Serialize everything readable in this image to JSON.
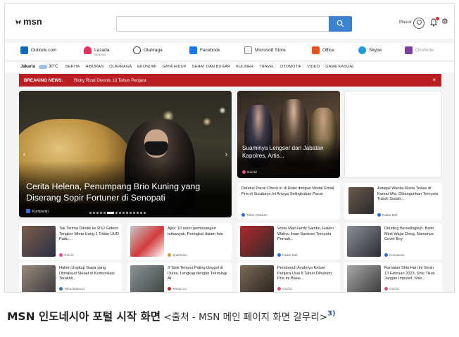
{
  "header": {
    "logo": "msn",
    "search_placeholder": "",
    "signin": "Masuk"
  },
  "quicklinks": [
    {
      "label": "Outlook.com",
      "color": "#0f6cbd",
      "icon": "outlook-icon"
    },
    {
      "label": "Lazada",
      "sub": "Sponsor",
      "color": "#e4325f",
      "icon": "lazada-icon"
    },
    {
      "label": "Olahraga",
      "color": "#444444",
      "icon": "sports-icon"
    },
    {
      "label": "Facebook",
      "color": "#1877f2",
      "icon": "facebook-icon"
    },
    {
      "label": "Microsoft Store",
      "color": "#777777",
      "icon": "store-icon"
    },
    {
      "label": "Office",
      "color": "#e5541c",
      "icon": "office-icon"
    },
    {
      "label": "Skype",
      "color": "#1e9bd8",
      "icon": "skype-icon"
    },
    {
      "label": "OneNote",
      "color": "#7b3fa0",
      "icon": "onenote-icon"
    }
  ],
  "nav": {
    "city": "Jakarta",
    "temp": "30°C",
    "items": [
      "BERITA",
      "HIBURAN",
      "OLAHRAGA",
      "EKONOMI",
      "GAYA HIDUP",
      "SEHAT DAN BUGAR",
      "KULINER",
      "TRAVEL",
      "OTOMOTIF",
      "VIDEO",
      "GAME KASUAL"
    ]
  },
  "breaking": {
    "label": "BREAKING NEWS:",
    "text": "Ricky Rizal Divonis 13 Tahun Penjara",
    "close": "×"
  },
  "hero": {
    "title": "Cerita Helena, Penumpang Brio Kuning yang Diserang Sopir Fortuner di Senopati",
    "source": "Kumparan"
  },
  "feature": {
    "title": "Suaminya Lengser dari Jabatan Kapolres, Artis...",
    "source": "Grid.id"
  },
  "cards": [
    {
      "title": "Deteksi Pacar Check in di Hotel dengan Modal Email, Pria di Surabaya Ini Aniaya Selingkuhan Pacar",
      "source": "Tribun Madura",
      "thumb": false
    },
    {
      "title": "Astagal Wanita Rusia Tewas di Kamar Mia, Dibangunkan Ternyata Tubuh Sudah...",
      "source": "Radar Bali",
      "thumb": true
    },
    {
      "title": "Tak Terima Dikritik ke RSJ Gideon Tengker Minta Uang 1 Triliun UUD Padu...",
      "source": "Grid.id",
      "thumb": true
    },
    {
      "title": "Ajax: 10 rekor pembuangan terbanyak. Peringkat dalam foto",
      "source": "Sportsdeu",
      "thumb": true
    },
    {
      "title": "Vonis Mati Ferdy Sambo, Hakim Wahyu Iman Santoso Ternyata Pernah...",
      "source": "Radar Bali",
      "thumb": true
    },
    {
      "title": "Dituding Berselingkuh, Baim Minit Wajar Dong, Namanya Cover Boy",
      "source": "Kumparan",
      "thumb": true
    },
    {
      "title": "Hakim Ungkap Siapa yang Dimaksud Skuad di Komunikasi Terakhir...",
      "source": "Tribunkabar.id",
      "thumb": true
    },
    {
      "title": "3 Tank Tempur Paling Unggul di Dunia, Lengkap dengan Teknologi AI",
      "source": "Tempo.co",
      "thumb": true
    },
    {
      "title": "Pembunuh Ayahnya Keluar Penjara Usai 8 Tahun Dihukum, Pria Ini Balas...",
      "source": "Grid.id",
      "thumb": true
    },
    {
      "title": "Ramalan Shio Hari Ini Senin 13 Februari 2023, Shio Tikus Jangan Impulsif, Shio...",
      "source": "Grid.id",
      "thumb": true
    }
  ],
  "caption": {
    "main": "MSN 인도네시아 포털 시작 화면",
    "sub": "<출처 - MSN 메인 페이지 화면 갈무리>",
    "sup": "3)"
  }
}
